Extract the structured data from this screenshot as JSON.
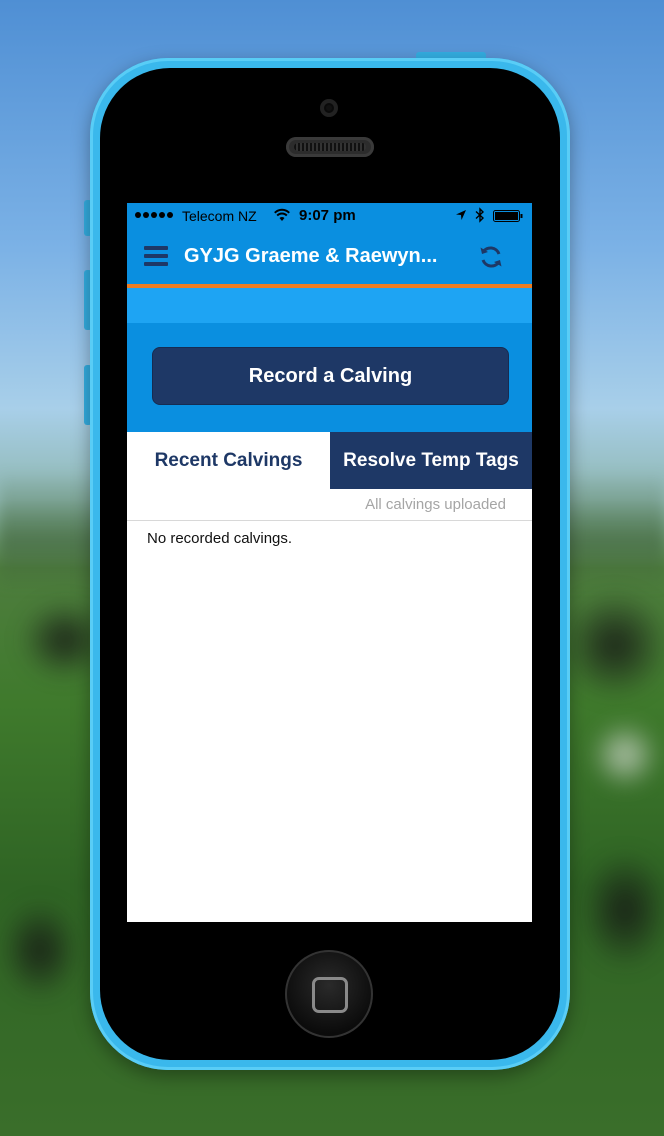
{
  "status_bar": {
    "carrier": "Telecom NZ",
    "time": "9:07 pm"
  },
  "nav": {
    "title": "GYJG Graeme & Raewyn..."
  },
  "actions": {
    "record_label": "Record a Calving"
  },
  "tabs": [
    {
      "label": "Recent Calvings",
      "selected": true
    },
    {
      "label": "Resolve Temp Tags",
      "selected": false
    }
  ],
  "upload_status": "All calvings uploaded",
  "empty_message": "No recorded calvings.",
  "colors": {
    "nav_blue": "#0a8fe0",
    "accent_orange": "#ef7d22",
    "navy": "#1e3866",
    "phone_body": "#3ab8ec"
  }
}
